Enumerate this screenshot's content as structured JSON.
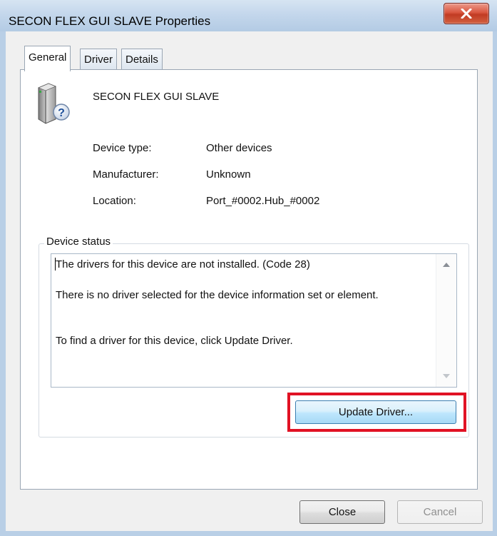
{
  "window": {
    "title": "SECON FLEX GUI SLAVE Properties",
    "close_icon": "close-x-icon"
  },
  "tabs": [
    {
      "label": "General",
      "active": true
    },
    {
      "label": "Driver",
      "active": false
    },
    {
      "label": "Details",
      "active": false
    }
  ],
  "device": {
    "icon": "unknown-device-icon",
    "name": "SECON FLEX GUI SLAVE"
  },
  "properties": [
    {
      "label": "Device type:",
      "value": "Other devices"
    },
    {
      "label": "Manufacturer:",
      "value": "Unknown"
    },
    {
      "label": "Location:",
      "value": "Port_#0002.Hub_#0002"
    }
  ],
  "status": {
    "group_label": "Device status",
    "lines": [
      "The drivers for this device are not installed. (Code 28)",
      "There is no driver selected for the device information set or element.",
      "To find a driver for this device, click Update Driver."
    ]
  },
  "buttons": {
    "update_driver": "Update Driver...",
    "close": "Close",
    "cancel": "Cancel"
  },
  "colors": {
    "highlight": "#e11224",
    "titlebar": "#c4d7ec",
    "close_button": "#c13b24"
  }
}
